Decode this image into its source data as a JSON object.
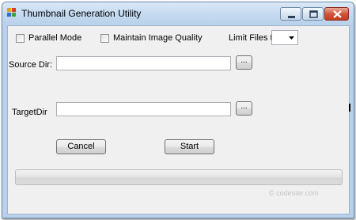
{
  "window": {
    "title": "Thumbnail Generation Utility"
  },
  "options": {
    "parallel_mode_label": "Parallel Mode",
    "parallel_mode_checked": false,
    "maintain_quality_label": "Maintain Image Quality",
    "maintain_quality_checked": false,
    "limit_files_label": "Limit Files to",
    "limit_files_value": ""
  },
  "source": {
    "label": "Source Dir:",
    "value": "",
    "browse_label": "..."
  },
  "target": {
    "label": "TargetDir",
    "value": "",
    "browse_label": "..."
  },
  "buttons": {
    "cancel_label": "Cancel",
    "start_label": "Start"
  },
  "progress": {
    "value": 0
  },
  "watermark": "© codester.com",
  "icons": {
    "app": "app-icon",
    "minimize": "minimize-icon",
    "maximize": "maximize-icon",
    "close": "close-icon",
    "dropdown": "chevron-down-icon"
  }
}
